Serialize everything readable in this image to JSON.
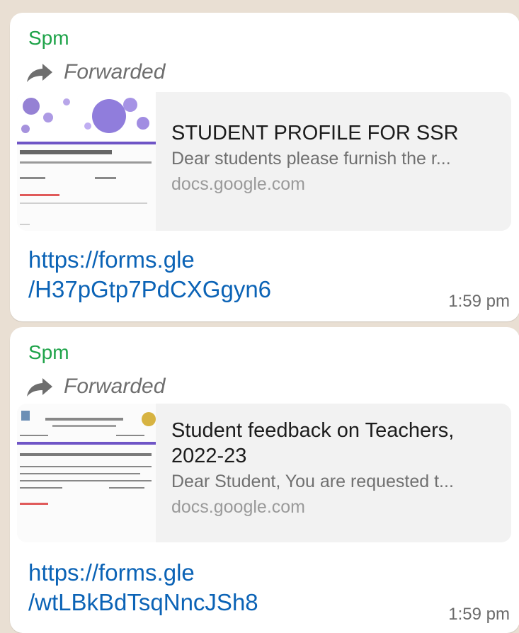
{
  "messages": [
    {
      "sender": "Spm",
      "forwarded_label": "Forwarded",
      "preview": {
        "title": "STUDENT PROFILE FOR SSR",
        "description": "Dear students please furnish the r...",
        "domain": "docs.google.com"
      },
      "link_line_1": "https://forms.gle",
      "link_line_2": "/H37pGtp7PdCXGgyn6",
      "time": "1:59 pm"
    },
    {
      "sender": "Spm",
      "forwarded_label": "Forwarded",
      "preview": {
        "title": "Student feedback on Teachers, 2022-23",
        "description": "Dear Student, You are requested t...",
        "domain": "docs.google.com"
      },
      "link_line_1": "https://forms.gle",
      "link_line_2": "/wtLBkBdTsqNncJSh8",
      "time": "1:59 pm"
    }
  ],
  "colors": {
    "sender": "#1ea349",
    "link": "#0b63b6",
    "chat_background": "#e9dfd3"
  },
  "icons": {
    "forward": "forward-arrow-icon"
  }
}
